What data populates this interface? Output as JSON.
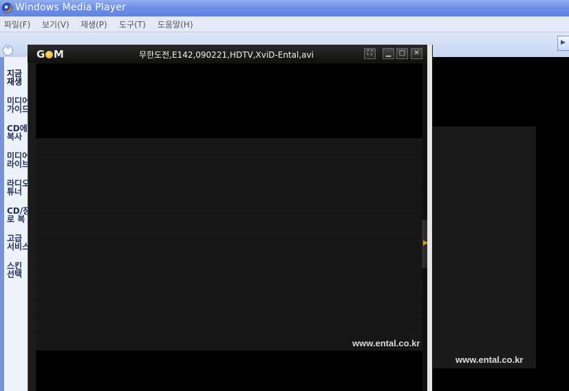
{
  "wmp": {
    "title": "Windows Media Player",
    "menu": [
      "파일(F)",
      "보기(V)",
      "재생(P)",
      "도구(T)",
      "도움말(H)"
    ],
    "sidebar": [
      {
        "label": "지금\n재생",
        "active": true
      },
      {
        "label": "미디어\n가이드"
      },
      {
        "label": "CD에\n복사"
      },
      {
        "label": "미디어\n라이브"
      },
      {
        "label": "라디오\n튜너"
      },
      {
        "label": "CD/장\n로 복"
      },
      {
        "label": "고급\n서비스"
      },
      {
        "label": "스킨\n선택"
      }
    ],
    "watermark": "www.ental.co.kr"
  },
  "gom": {
    "logo": "GOM",
    "filename": "무한도전,E142,090221,HDTV,XviD-Ental,avi",
    "watermark": "www.ental.co.kr",
    "buttons": {
      "fullscreen": "⛶",
      "minimize": "▁",
      "maximize": "□",
      "close": "✕"
    }
  }
}
